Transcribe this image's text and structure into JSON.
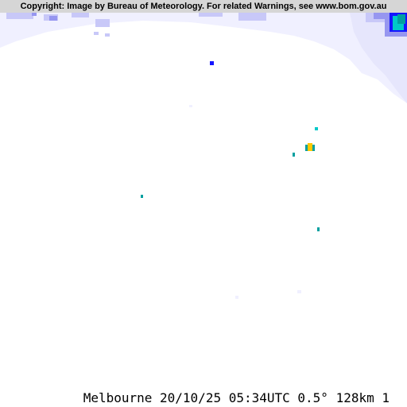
{
  "header": {
    "copyright": "Copyright: Image by Bureau of Meteorology. For related Warnings, see www.bom.gov.au"
  },
  "footer": {
    "status": "Melbourne 20/10/25 05:34UTC 0.5° 128km 1"
  },
  "radar": {
    "location": "Melbourne",
    "date": "20/10/25",
    "time_utc": "05:34UTC",
    "elevation": "0.5°",
    "range": "128km",
    "colors": {
      "background": "#ffffff",
      "land_tint": "#f0f0ff",
      "light_rain": "#c8c8f8",
      "moderate": "#9696f0",
      "heavy_blue": "#1414ff",
      "teal": "#00a0a0",
      "cyan": "#00c8c8",
      "yellow": "#ffc800"
    }
  }
}
